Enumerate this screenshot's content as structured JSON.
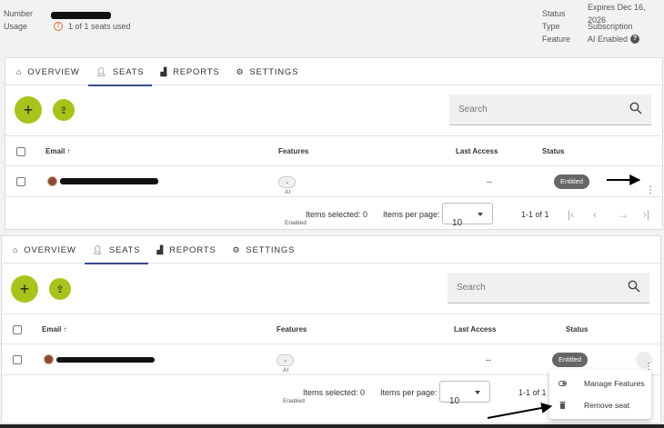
{
  "info": {
    "number_label": "Number",
    "usage_label": "Usage",
    "usage_value": "1 of 1 seats used",
    "status_label": "Status",
    "status_value": "Expires Dec 16, 2026",
    "type_label": "Type",
    "type_value": "Subscription",
    "feature_label": "Feature",
    "feature_value": "AI Enabled"
  },
  "tabs": [
    {
      "label": "OVERVIEW",
      "icon": "home-icon"
    },
    {
      "label": "SEATS",
      "icon": "person-icon"
    },
    {
      "label": "REPORTS",
      "icon": "chart-icon"
    },
    {
      "label": "SETTINGS",
      "icon": "gear-icon"
    }
  ],
  "active_tab": "SEATS",
  "search": {
    "placeholder": "Search"
  },
  "table": {
    "columns": [
      "Email",
      "Features",
      "Last Access",
      "Status"
    ],
    "rows": [
      {
        "email": "",
        "feature_chip": "AI Enabled",
        "last_access": "--",
        "status": "Entitled"
      }
    ]
  },
  "pagination": {
    "items_selected": "Items selected: 0",
    "items_per_page_label": "Items per page:",
    "items_per_page": "10",
    "range": "1-1 of 1"
  },
  "row_menu": {
    "items": [
      {
        "label": "Manage Features",
        "icon": "toggle-icon"
      },
      {
        "label": "Remove seat",
        "icon": "trash-icon"
      }
    ]
  },
  "colors": {
    "accent_green": "#a9c31c",
    "tab_underline": "#3a4a8c",
    "badge": "#666666",
    "warning": "#e06a2c"
  }
}
